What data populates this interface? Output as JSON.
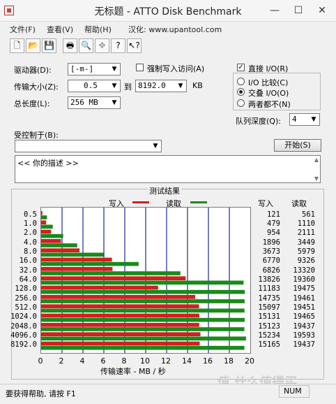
{
  "window": {
    "title": "无标题 - ATTO Disk Benchmark"
  },
  "menu": [
    "文件(F)",
    "查看(V)",
    "帮助(H)",
    "汉化: www.upantool.com"
  ],
  "form": {
    "drive_label": "驱动器(D):",
    "drive_value": "[-m-]",
    "force_write_label": "强制写入访问(A)",
    "transfer_label": "传输大小(Z):",
    "transfer_from": "0.5",
    "to_label": "到",
    "transfer_to": "8192.0",
    "kb_label": "KB",
    "total_label": "总长度(L):",
    "total_value": "256 MB",
    "direct_io_label": "直接 I/O(R)",
    "io_options": [
      "I/O 比较(C)",
      "交叠 I/O(O)",
      "两者都不(N)"
    ],
    "io_selected": 1,
    "queue_label": "队列深度(Q):",
    "queue_value": "4",
    "controlled_label": "受控制于(B):",
    "start_label": "开始(S)",
    "description": "<<   你的描述    >>"
  },
  "results": {
    "group_label": "测试结果",
    "write_legend": "写入",
    "read_legend": "读取",
    "write_header": "写入",
    "read_header": "读取",
    "xlabel": "传输速率 - MB / 秒"
  },
  "chart_data": {
    "type": "bar",
    "orientation": "horizontal",
    "categories": [
      "0.5",
      "1.0",
      "2.0",
      "4.0",
      "8.0",
      "16.0",
      "32.0",
      "64.0",
      "128.0",
      "256.0",
      "512.0",
      "1024.0",
      "2048.0",
      "4096.0",
      "8192.0"
    ],
    "series": [
      {
        "name": "写入",
        "color": "#d02020",
        "values": [
          121,
          479,
          954,
          1896,
          3673,
          6770,
          6826,
          13826,
          11183,
          14735,
          15097,
          15131,
          15123,
          15234,
          15165
        ]
      },
      {
        "name": "读取",
        "color": "#1a8a1a",
        "values": [
          561,
          1110,
          2111,
          3449,
          5979,
          9326,
          13320,
          19360,
          19475,
          19461,
          19451,
          19465,
          19437,
          19593,
          19437
        ]
      }
    ],
    "xlim": [
      0,
      20
    ],
    "xticks": [
      "0",
      "2",
      "4",
      "6",
      "8",
      "10",
      "12",
      "14",
      "16",
      "18",
      "20"
    ],
    "xlabel": "传输速率 - MB / 秒",
    "grid": true
  },
  "status": {
    "help": "要获得帮助, 请按 F1",
    "num": "NUM"
  },
  "watermark": "值 什么值得买"
}
